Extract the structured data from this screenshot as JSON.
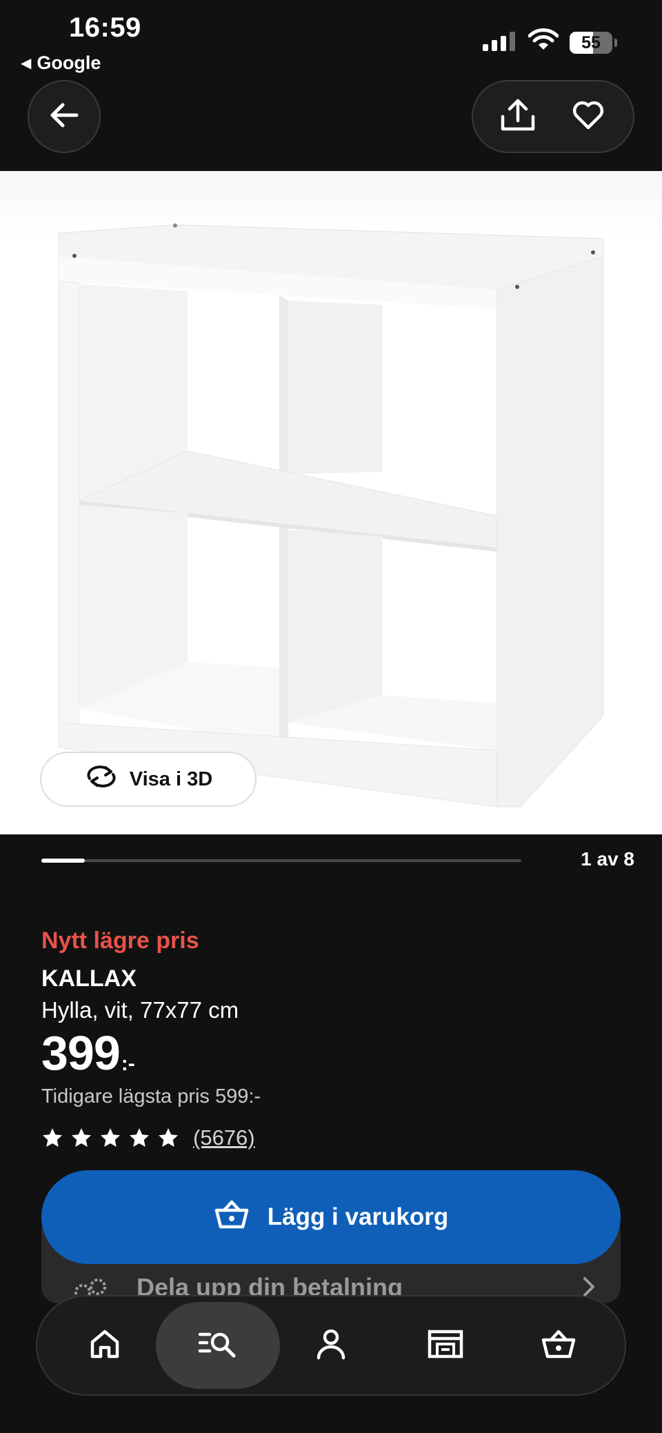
{
  "status_bar": {
    "time": "16:59",
    "back_app": "Google",
    "battery_pct": "55",
    "battery_level": 0.55
  },
  "top_nav": {
    "back_icon": "arrow-left-icon",
    "share_icon": "share-icon",
    "favorite_icon": "heart-icon"
  },
  "hero": {
    "view_3d_label": "Visa i 3D",
    "view_3d_icon": "rotate-icon",
    "carousel_index": 1,
    "carousel_total": 8,
    "carousel_counter": "1 av 8"
  },
  "product": {
    "badge": "Nytt lägre pris",
    "name": "KALLAX",
    "description": "Hylla, vit, 77x77 cm",
    "price_integer": "399",
    "price_suffix": ":-",
    "previous_price": "Tidigare lägsta pris 599:-",
    "rating_stars": 5,
    "review_count": "(5676)"
  },
  "actions": {
    "add_to_cart": "Lägg i varukorg",
    "split_payment": "Dela upp din betalning"
  },
  "tab_bar": {
    "items": [
      {
        "name": "home",
        "icon": "home-icon"
      },
      {
        "name": "search",
        "icon": "search-icon",
        "active": true
      },
      {
        "name": "profile",
        "icon": "person-icon"
      },
      {
        "name": "stores",
        "icon": "store-icon"
      },
      {
        "name": "cart",
        "icon": "basket-icon"
      }
    ]
  },
  "colors": {
    "background": "#111111",
    "badge_red": "#e8524a",
    "cart_blue": "#0f5fb9"
  }
}
